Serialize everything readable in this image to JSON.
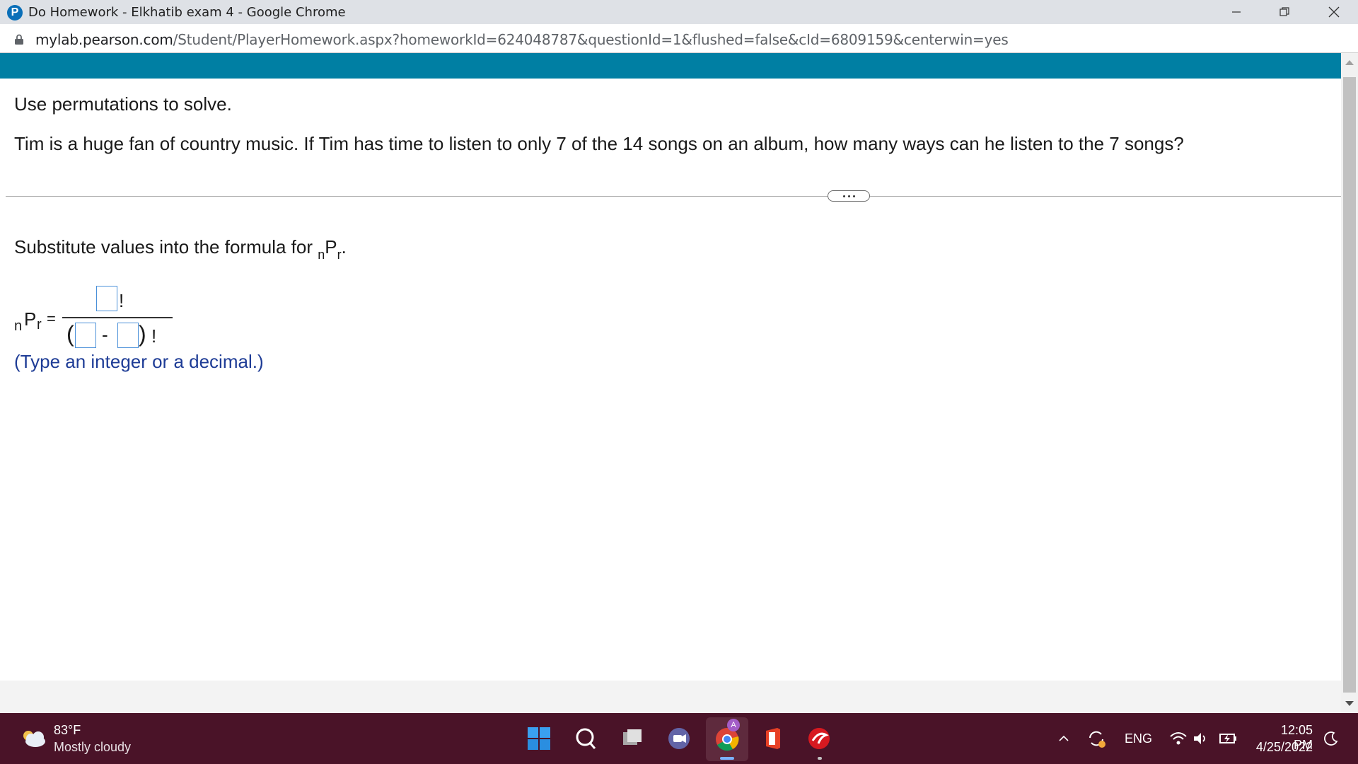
{
  "window": {
    "title": "Do Homework - Elkhatib exam 4 - Google Chrome"
  },
  "address_bar": {
    "host": "mylab.pearson.com",
    "path": "/Student/PlayerHomework.aspx?homeworkId=624048787&questionId=1&flushed=false&cId=6809159&centerwin=yes"
  },
  "question": {
    "instruction": "Use permutations to solve.",
    "text": "Tim is a huge fan of country music. If Tim has time to listen to only 7 of the 14 songs on an album, how many ways can he listen to the 7 songs?"
  },
  "step": {
    "prompt_prefix": "Substitute values into the formula for ",
    "formula_n": "n",
    "formula_P": "P",
    "formula_r": "r",
    "prompt_suffix": ".",
    "equals": "=",
    "bang": "!",
    "open_paren": "(",
    "minus": "-",
    "close_paren": ")",
    "hint": "(Type an integer or a decimal.)",
    "inputs": {
      "numerator": "",
      "denominator_n": "",
      "denominator_r": ""
    }
  },
  "taskbar": {
    "temperature": "83°F",
    "weather": "Mostly cloudy",
    "language": "ENG",
    "time": "12:05 PM",
    "date": "4/25/2022",
    "icons": [
      "windows-start-icon",
      "search-icon",
      "task-view-icon",
      "teams-chat-icon",
      "chrome-icon",
      "office-icon",
      "trend-micro-icon"
    ]
  },
  "colors": {
    "teal_header": "#007fa3",
    "hint_text": "#1e3c96",
    "input_border": "#4a90d9",
    "taskbar": "#4a1328"
  }
}
